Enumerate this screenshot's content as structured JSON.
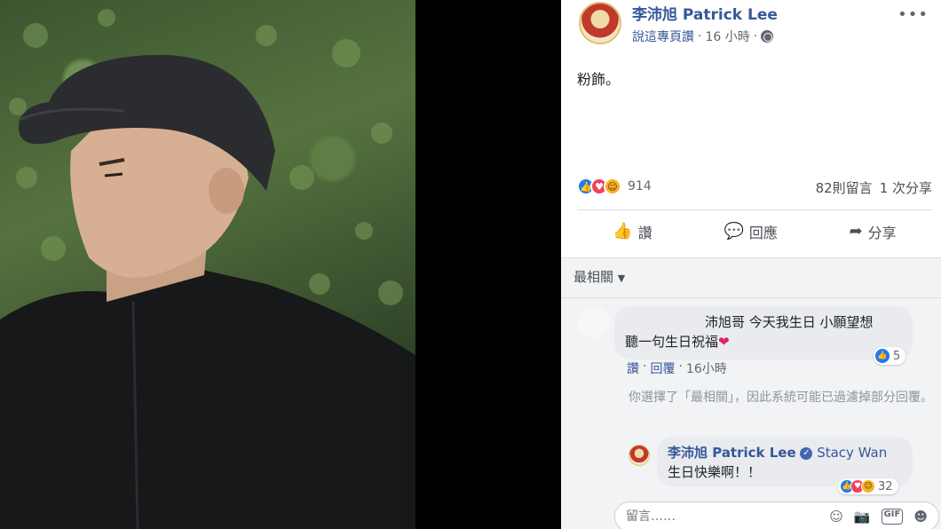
{
  "post": {
    "page_name": "李沛旭 Patrick Lee",
    "like_label": "說這專頁讚",
    "separator": "·",
    "time": "16 小時",
    "text": "粉飾。",
    "reaction_count": "914",
    "comments_count": "82則留言",
    "shares_count": "1 次分享"
  },
  "actions": {
    "like": "讚",
    "comment": "回應",
    "share": "分享"
  },
  "comments": {
    "sort_label": "最相關",
    "c1": {
      "line1": "沛旭哥 今天我生日 小願望想",
      "line2": "聽一句生日祝福",
      "heart": "❤",
      "likes": "5",
      "like_link": "讚",
      "reply_link": "回覆",
      "time": "16小時"
    },
    "filter_note": "你選擇了「最相關」，因此系統可能已過濾掉部分回覆。",
    "reply": {
      "author": "李沛旭 Patrick Lee",
      "tagged": "Stacy Wan",
      "text": "生日快樂啊！！",
      "reactions": "32"
    },
    "input_placeholder": "留言……"
  },
  "icons": {
    "more": "more-dots-icon",
    "globe": "globe-icon",
    "like": "thumbs-up-icon",
    "comment": "speech-bubble-icon",
    "share": "share-arrow-icon",
    "emoji": "emoji-icon",
    "camera": "camera-icon",
    "gif": "gif-icon",
    "sticker": "sticker-icon"
  },
  "colors": {
    "link": "#365899",
    "like_blue": "#2078f4",
    "love_red": "#f33e58",
    "haha_yellow": "#f7b125"
  }
}
